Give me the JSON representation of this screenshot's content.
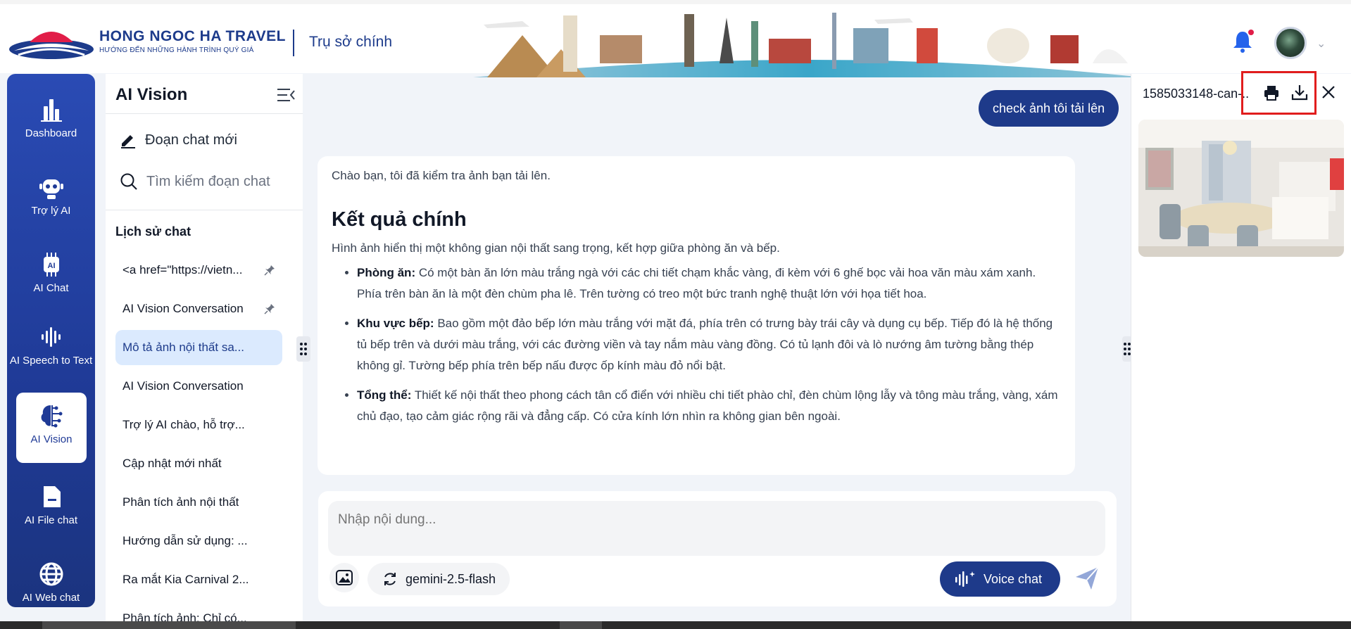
{
  "header": {
    "brand_name": "HONG NGOC HA TRAVEL",
    "brand_tagline": "HƯỚNG ĐẾN NHỮNG HÀNH TRÌNH QUÝ GIÁ",
    "location": "Trụ sở chính"
  },
  "nav": {
    "items": [
      {
        "label": "Dashboard",
        "icon": "bar-chart-icon"
      },
      {
        "label": "Trợ lý AI",
        "icon": "robot-icon"
      },
      {
        "label": "AI Chat",
        "icon": "ai-chip-icon"
      },
      {
        "label": "AI Speech to Text",
        "icon": "soundwave-icon"
      },
      {
        "label": "AI Vision",
        "icon": "brain-icon",
        "active": true
      },
      {
        "label": "AI File chat",
        "icon": "file-icon"
      },
      {
        "label": "AI Web chat",
        "icon": "globe-icon"
      }
    ]
  },
  "sidebar": {
    "title": "AI Vision",
    "new_chat": "Đoạn chat mới",
    "search_placeholder": "Tìm kiếm đoạn chat",
    "history_title": "Lịch sử chat",
    "history": [
      {
        "label": "<a href=\"https://vietn...",
        "pinned": true
      },
      {
        "label": "AI Vision Conversation",
        "pinned": true
      },
      {
        "label": "Mô tả ảnh nội thất sa...",
        "active": true
      },
      {
        "label": "AI Vision Conversation"
      },
      {
        "label": "Trợ lý AI chào, hỗ trợ..."
      },
      {
        "label": "Cập nhật mới nhất"
      },
      {
        "label": "Phân tích ảnh nội thất"
      },
      {
        "label": "Hướng dẫn sử dụng: ..."
      },
      {
        "label": "Ra mắt Kia Carnival 2..."
      },
      {
        "label": "Phân tích ảnh: Chỉ có..."
      }
    ]
  },
  "chat": {
    "user_message": "check ảnh tôi tải lên",
    "answer": {
      "greeting": "Chào bạn, tôi đã kiểm tra ảnh bạn tải lên.",
      "heading": "Kết quả chính",
      "intro": "Hình ảnh hiển thị một không gian nội thất sang trọng, kết hợp giữa phòng ăn và bếp.",
      "bullets": [
        {
          "title": "Phòng ăn:",
          "text": " Có một bàn ăn lớn màu trắng ngà với các chi tiết chạm khắc vàng, đi kèm với 6 ghế bọc vải hoa văn màu xám xanh. Phía trên bàn ăn là một đèn chùm pha lê. Trên tường có treo một bức tranh nghệ thuật lớn với họa tiết hoa."
        },
        {
          "title": "Khu vực bếp:",
          "text": " Bao gồm một đảo bếp lớn màu trắng với mặt đá, phía trên có trưng bày trái cây và dụng cụ bếp. Tiếp đó là hệ thống tủ bếp trên và dưới màu trắng, với các đường viền và tay nắm màu vàng đồng. Có tủ lạnh đôi và lò nướng âm tường bằng thép không gỉ. Tường bếp phía trên bếp nấu được ốp kính màu đỏ nổi bật."
        },
        {
          "title": "Tổng thể:",
          "text": " Thiết kế nội thất theo phong cách tân cổ điển với nhiều chi tiết phào chỉ, đèn chùm lộng lẫy và tông màu trắng, vàng, xám chủ đạo, tạo cảm giác rộng rãi và đẳng cấp. Có cửa kính lớn nhìn ra không gian bên ngoài."
        }
      ]
    },
    "composer": {
      "placeholder": "Nhập nội dung...",
      "model": "gemini-2.5-flash",
      "voice_label": "Voice chat"
    }
  },
  "preview": {
    "filename": "1585033148-can-..."
  },
  "colors": {
    "primary": "#1e3a8a",
    "nav_bg": "#2a4bb4",
    "active_chat_bg": "#dbeafe",
    "highlight": "#e11d1d"
  }
}
